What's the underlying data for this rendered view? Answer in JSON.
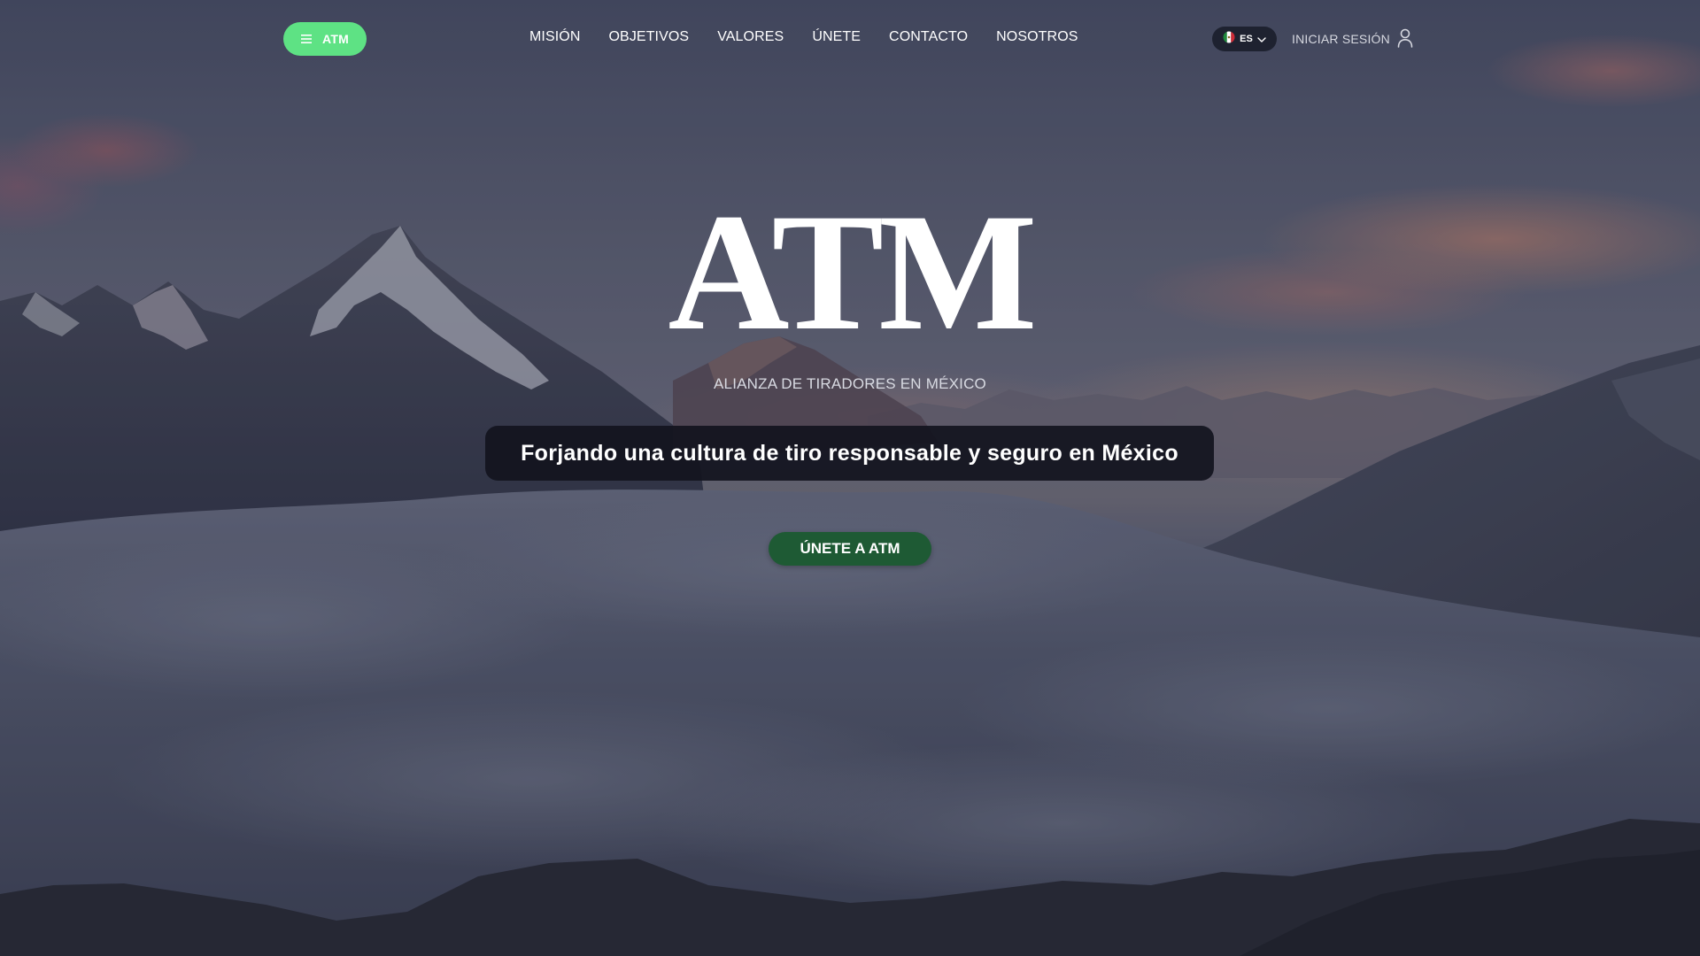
{
  "header": {
    "menu_label": "ATM",
    "nav": [
      {
        "label": "MISIÓN"
      },
      {
        "label": "OBJETIVOS"
      },
      {
        "label": "VALORES"
      },
      {
        "label": "ÚNETE"
      },
      {
        "label": "CONTACTO"
      },
      {
        "label": "NOSOTROS"
      }
    ],
    "language": {
      "code": "ES",
      "flag_icon": "mexico-flag-icon"
    },
    "login_label": "INICIAR SESIÓN",
    "user_icon": "user-icon"
  },
  "hero": {
    "title": "ATM",
    "subtitle": "ALIANZA DE TIRADORES EN MÉXICO",
    "tagline": "Forjando una cultura de tiro responsable y seguro en México",
    "cta_label": "ÚNETE A ATM"
  },
  "colors": {
    "menu_button": "#5ee284",
    "cta_button": "#1e5a34",
    "language_pill": "#1e2230",
    "tagline_box": "#12141e"
  }
}
